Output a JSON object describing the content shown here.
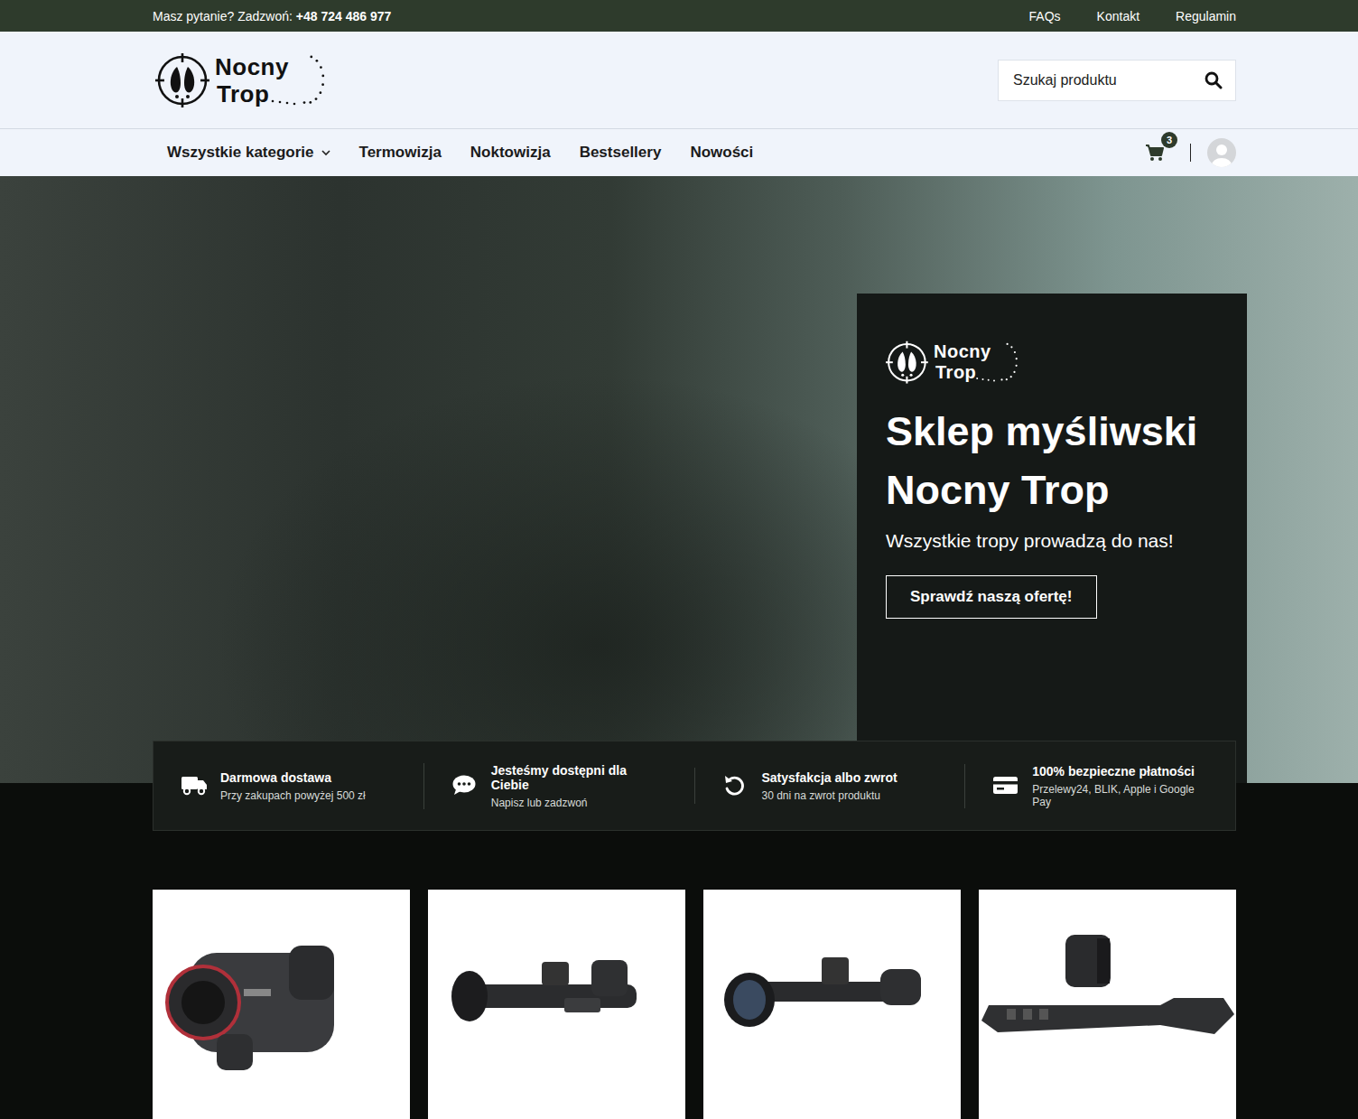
{
  "topbar": {
    "question": "Masz pytanie? Zadzwoń:",
    "phone": "+48 724 486 977",
    "links": [
      "FAQs",
      "Kontakt",
      "Regulamin"
    ]
  },
  "logo": {
    "line1": "Nocny",
    "line2": "Trop"
  },
  "search": {
    "placeholder": "Szukaj produktu"
  },
  "nav": {
    "items": [
      {
        "label": "Wszystkie kategorie",
        "kind": "dropdown"
      },
      {
        "label": "Termowizja",
        "kind": "link"
      },
      {
        "label": "Noktowizja",
        "kind": "link"
      },
      {
        "label": "Bestsellery",
        "kind": "link"
      },
      {
        "label": "Nowości",
        "kind": "link"
      }
    ],
    "cart_count": "3"
  },
  "hero": {
    "logo": {
      "line1": "Nocny",
      "line2": "Trop"
    },
    "title_line1": "Sklep myśliwski",
    "title_line2": "Nocny Trop",
    "subtitle": "Wszystkie tropy prowadzą do nas!",
    "button": "Sprawdź naszą ofertę!"
  },
  "features": [
    {
      "title": "Darmowa dostawa",
      "text": "Przy zakupach powyżej 500 zł",
      "kind": "truck"
    },
    {
      "title": "Jesteśmy dostępni dla Ciebie",
      "text": "Napisz lub zadzwoń",
      "kind": "chat"
    },
    {
      "title": "Satysfakcja albo zwrot",
      "text": "30 dni na zwrot produktu",
      "kind": "undo"
    },
    {
      "title": "100% bezpieczne płatności",
      "text": "Przelewy24, BLIK, Apple i Google Pay",
      "kind": "card"
    }
  ],
  "products": [
    {
      "kind": "monocular"
    },
    {
      "kind": "scope"
    },
    {
      "kind": "scope-large"
    },
    {
      "kind": "mount"
    }
  ]
}
